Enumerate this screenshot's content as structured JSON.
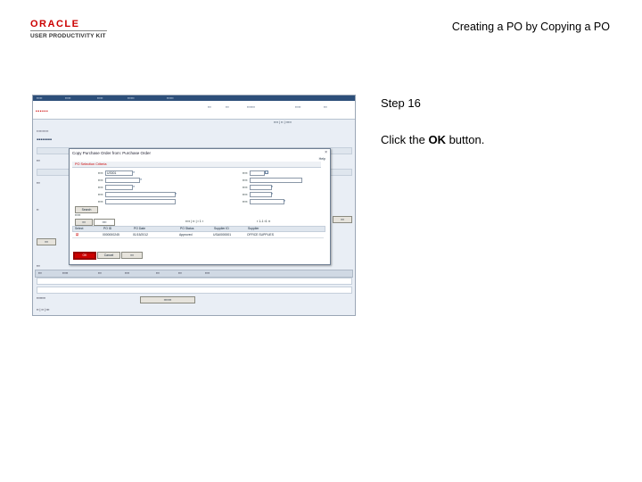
{
  "logo": {
    "word": "ORACLE",
    "subtitle": "USER PRODUCTIVITY KIT"
  },
  "doc_title": "Creating a PO by Copying a PO",
  "step": {
    "label": "Step 16"
  },
  "instruction": {
    "prefix": "Click the ",
    "bold": "OK",
    "suffix": " button."
  },
  "screenshot": {
    "modal_title": "Copy Purchase Order from: Purchase Order",
    "help": "Help",
    "section": "PO Selection Criteria",
    "fields": {
      "business_unit_value": "US001",
      "po_id_value": "0000000245",
      "search_button": "Search"
    },
    "grid_headers": [
      "Select",
      "PO ID",
      "PO Date",
      "PO Status",
      "Supplier ID",
      "Supplier"
    ],
    "grid_row": [
      "",
      "0000000245",
      "01/15/2012",
      "Approved",
      "USA0000001",
      "OFFICE SUPPLIES"
    ],
    "buttons": {
      "ok": "OK",
      "cancel": "Cancel"
    }
  },
  "colors": {
    "accent_red": "#cc0000",
    "portal_nav": "#2d4f7a"
  }
}
